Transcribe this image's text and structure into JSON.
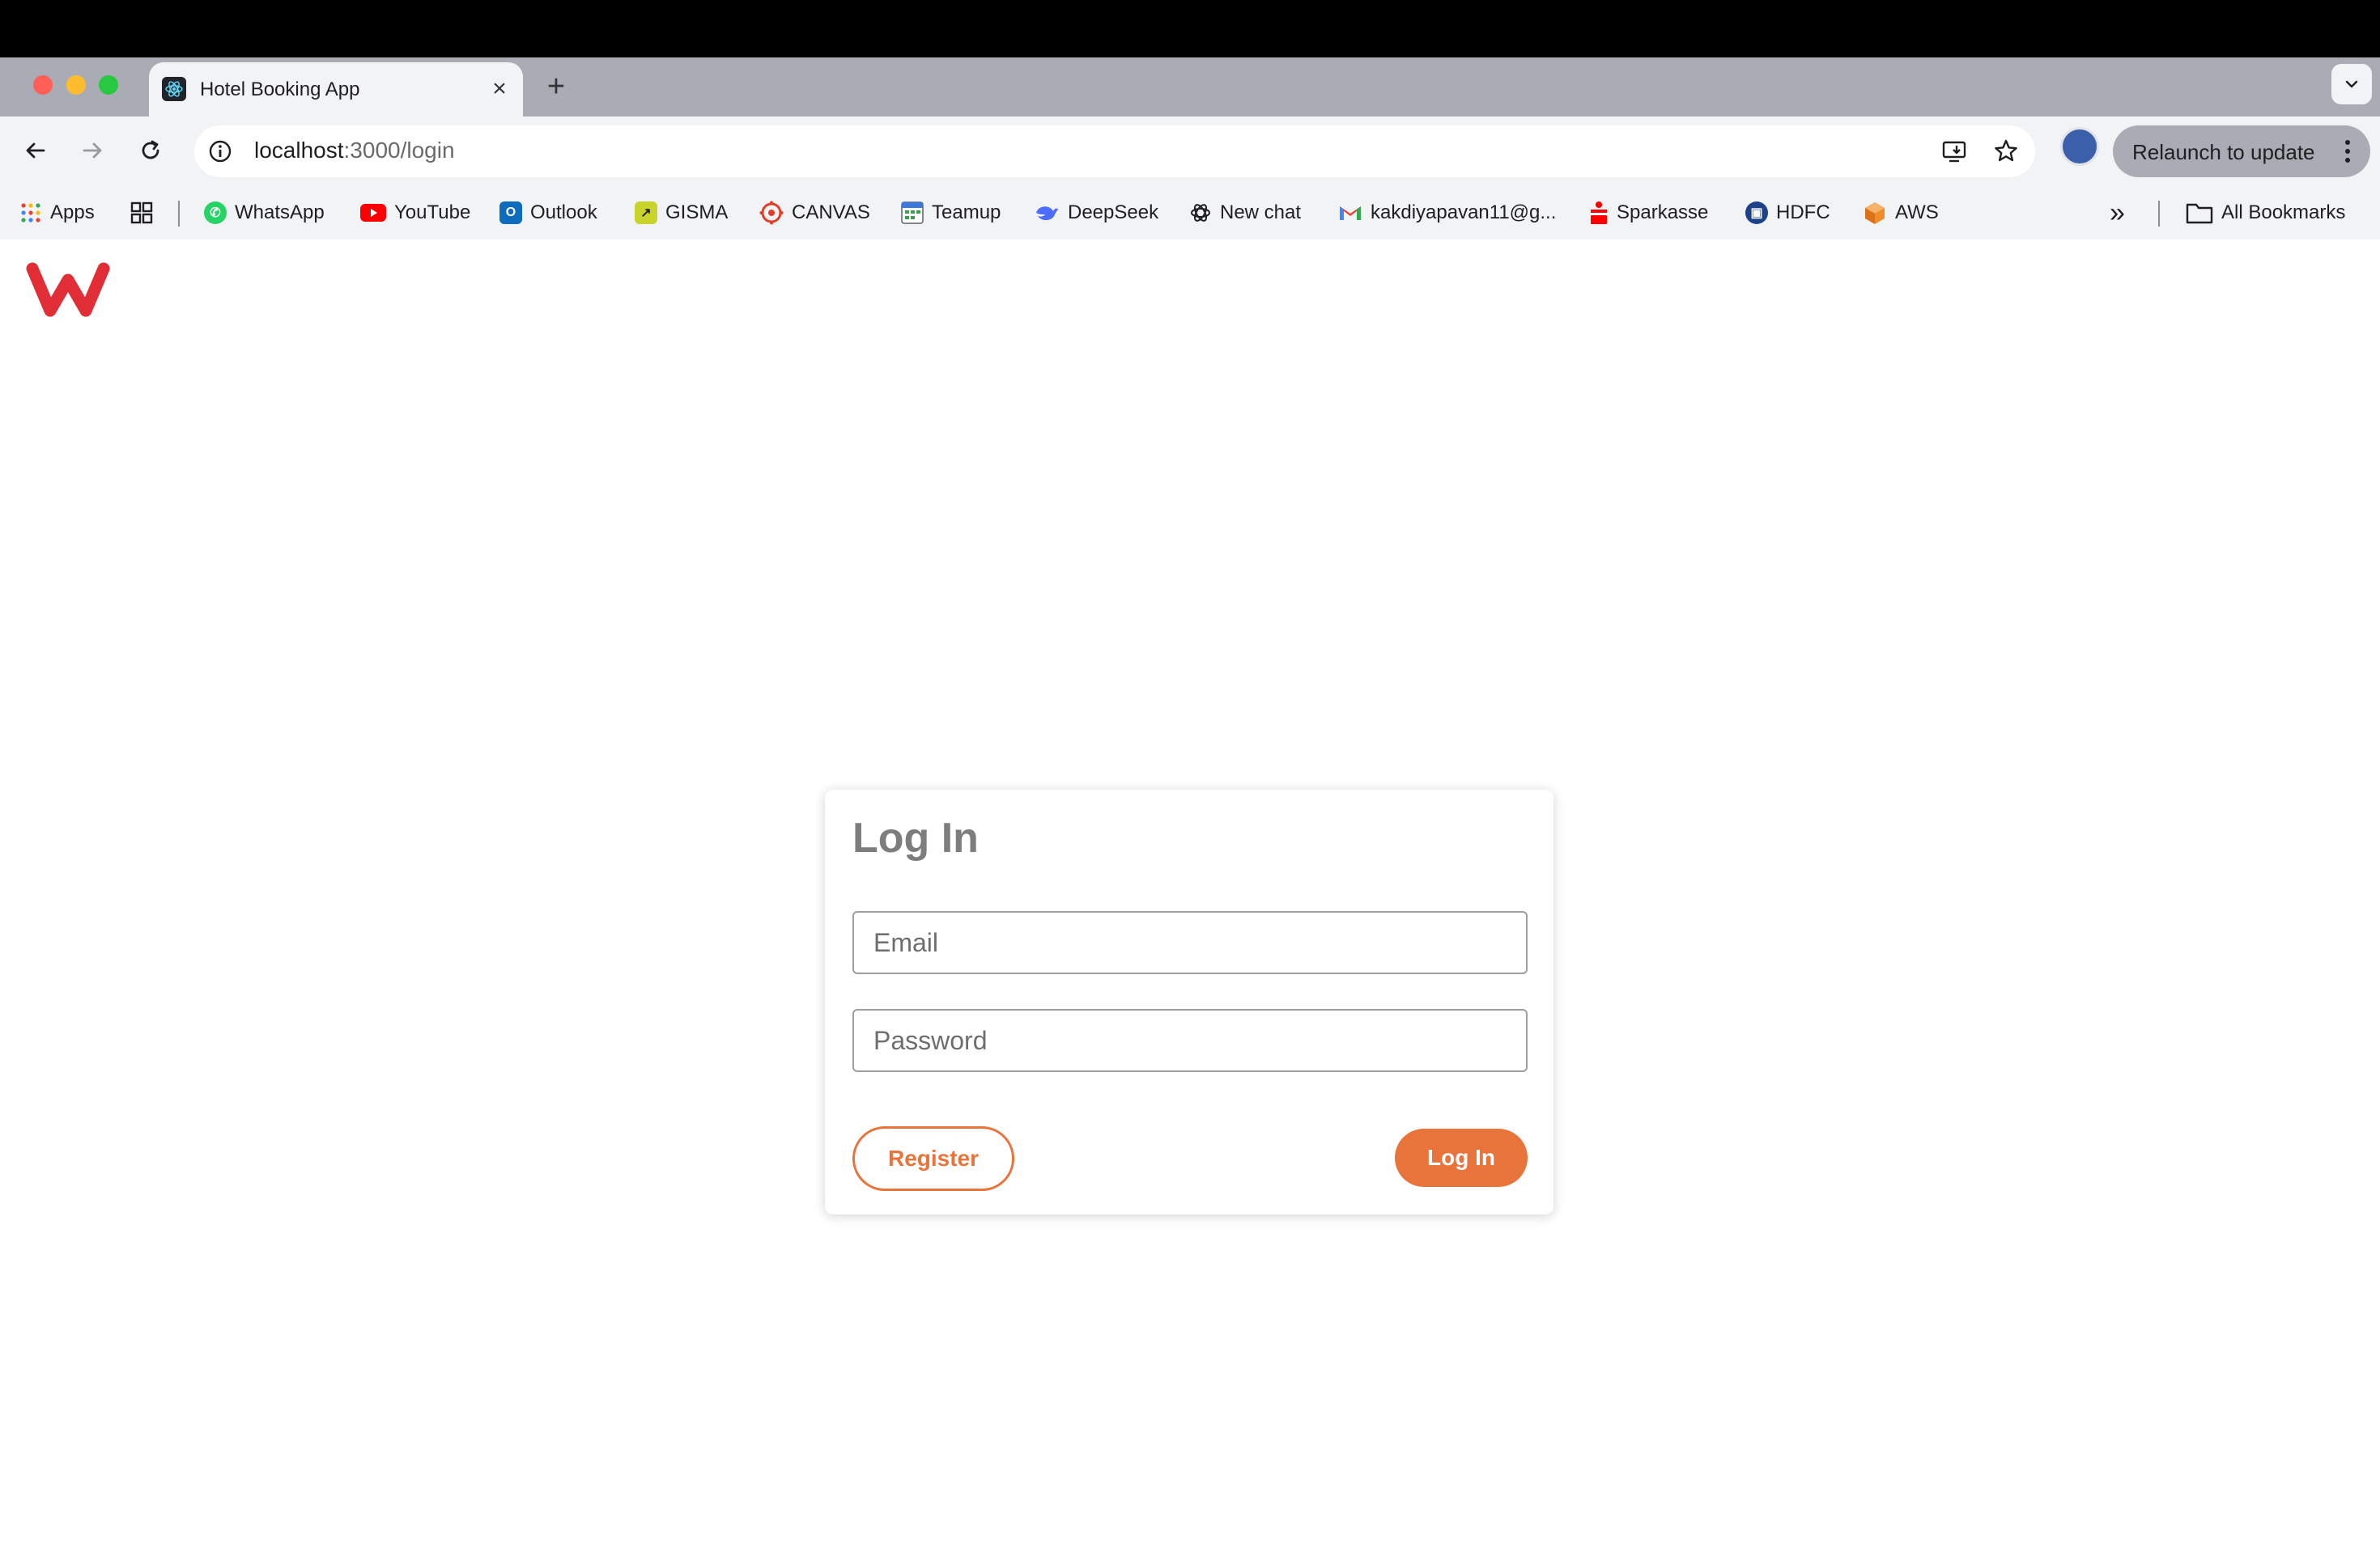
{
  "browser": {
    "tab": {
      "title": "Hotel Booking App",
      "favicon": "react-icon",
      "close": "×"
    },
    "new_tab": "+",
    "address": {
      "host": "localhost",
      "path": ":3000/login"
    },
    "relaunch_label": "Relaunch to update",
    "bookmarks": [
      {
        "label": "Apps",
        "icon": "apps-grid-icon"
      },
      {
        "label": "WhatsApp",
        "icon": "whatsapp-icon",
        "color": "#25d366"
      },
      {
        "label": "YouTube",
        "icon": "youtube-icon",
        "color": "#ff0000"
      },
      {
        "label": "Outlook",
        "icon": "outlook-icon",
        "color": "#0f6cbd"
      },
      {
        "label": "GISMA",
        "icon": "gisma-icon",
        "color": "#c8d42c"
      },
      {
        "label": "CANVAS",
        "icon": "canvas-icon",
        "color": "#e13f2b"
      },
      {
        "label": "Teamup",
        "icon": "teamup-icon",
        "color": "#3c9d4e"
      },
      {
        "label": "DeepSeek",
        "icon": "deepseek-icon",
        "color": "#4d6bfe"
      },
      {
        "label": "New chat",
        "icon": "openai-icon",
        "color": "#1f1f1f"
      },
      {
        "label": "kakdiyapavan11@g...",
        "icon": "gmail-icon",
        "color": "#ea4335"
      },
      {
        "label": "Sparkasse",
        "icon": "sparkasse-icon",
        "color": "#ff0000"
      },
      {
        "label": "HDFC",
        "icon": "hdfc-icon",
        "color": "#1d4289"
      },
      {
        "label": "AWS",
        "icon": "aws-icon",
        "color": "#f08c2a"
      }
    ],
    "overflow": "»",
    "all_bookmarks": "All Bookmarks"
  },
  "login": {
    "title": "Log In",
    "email_placeholder": "Email",
    "password_placeholder": "Password",
    "register_label": "Register",
    "login_label": "Log In"
  },
  "colors": {
    "accent": "#e8743b",
    "logo": "#e02d36"
  }
}
